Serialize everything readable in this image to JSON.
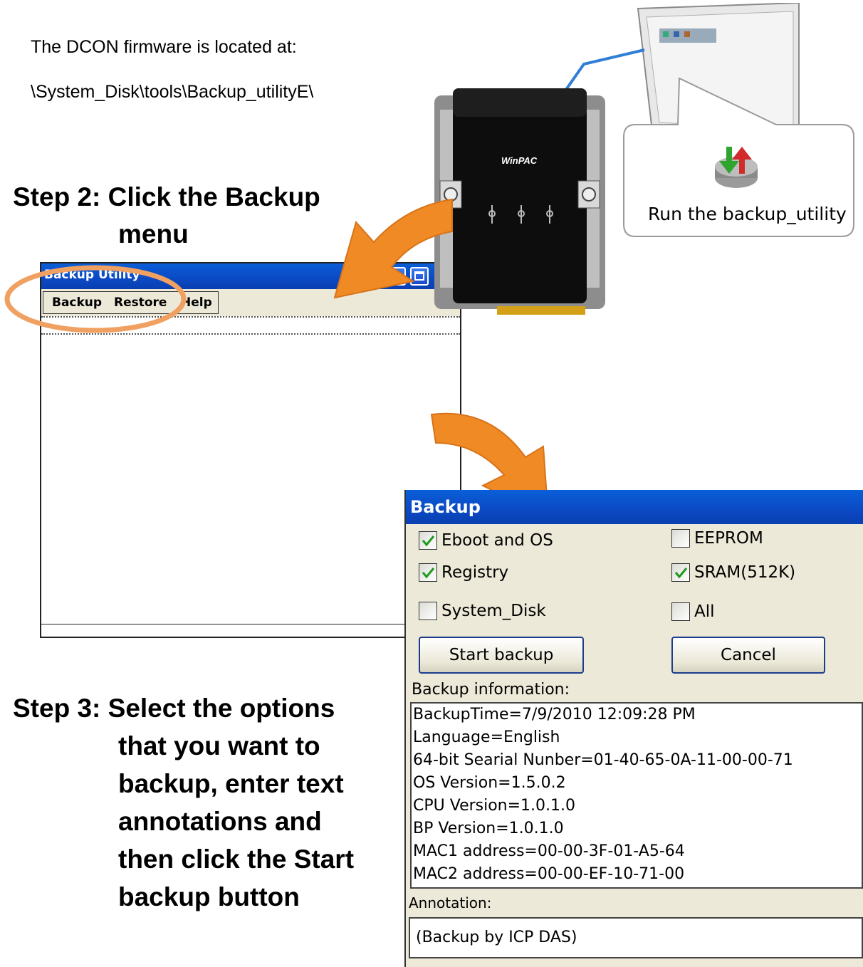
{
  "intro": {
    "line1": "The DCON firmware is located at:",
    "line2": "\\System_Disk\\tools\\Backup_utilityE\\"
  },
  "step2": {
    "line1": "Step 2: Click the Backup",
    "line2": "menu"
  },
  "step3": {
    "line1": "Step 3: Select the options",
    "line2": "that you want to",
    "line3": "backup, enter text",
    "line4": "annotations and",
    "line5": "then click the Start",
    "line6": "backup button"
  },
  "callout": {
    "label": "Run the backup_utility"
  },
  "device": {
    "logo": "WinPAC"
  },
  "utility_window": {
    "title": "Backup Utility",
    "menu": [
      "Backup",
      "Restore",
      "Help"
    ]
  },
  "backup_dialog": {
    "title": "Backup",
    "options": [
      {
        "label": "Eboot and OS",
        "checked": true
      },
      {
        "label": "EEPROM",
        "checked": false
      },
      {
        "label": "Registry",
        "checked": true
      },
      {
        "label": "SRAM(512K)",
        "checked": true
      },
      {
        "label": "System_Disk",
        "checked": false
      },
      {
        "label": "All",
        "checked": false
      }
    ],
    "start_label": "Start backup",
    "cancel_label": "Cancel",
    "info_label": "Backup information:",
    "info_lines": [
      "BackupTime=7/9/2010 12:09:28 PM",
      "Language=English",
      "64-bit Searial Nunber=01-40-65-0A-11-00-00-71",
      "OS Version=1.5.0.2",
      "CPU Version=1.0.1.0",
      "BP Version=1.0.1.0",
      "MAC1 address=00-00-3F-01-A5-64",
      "MAC2 address=00-00-EF-10-71-00"
    ],
    "annotation_label": "Annotation:",
    "annotation_value": "(Backup by ICP DAS)"
  },
  "colors": {
    "arrow": "#f08a24",
    "highlight_ring": "#f0a060",
    "titlebar": "#0b49c4",
    "check": "#1f9a1f"
  }
}
